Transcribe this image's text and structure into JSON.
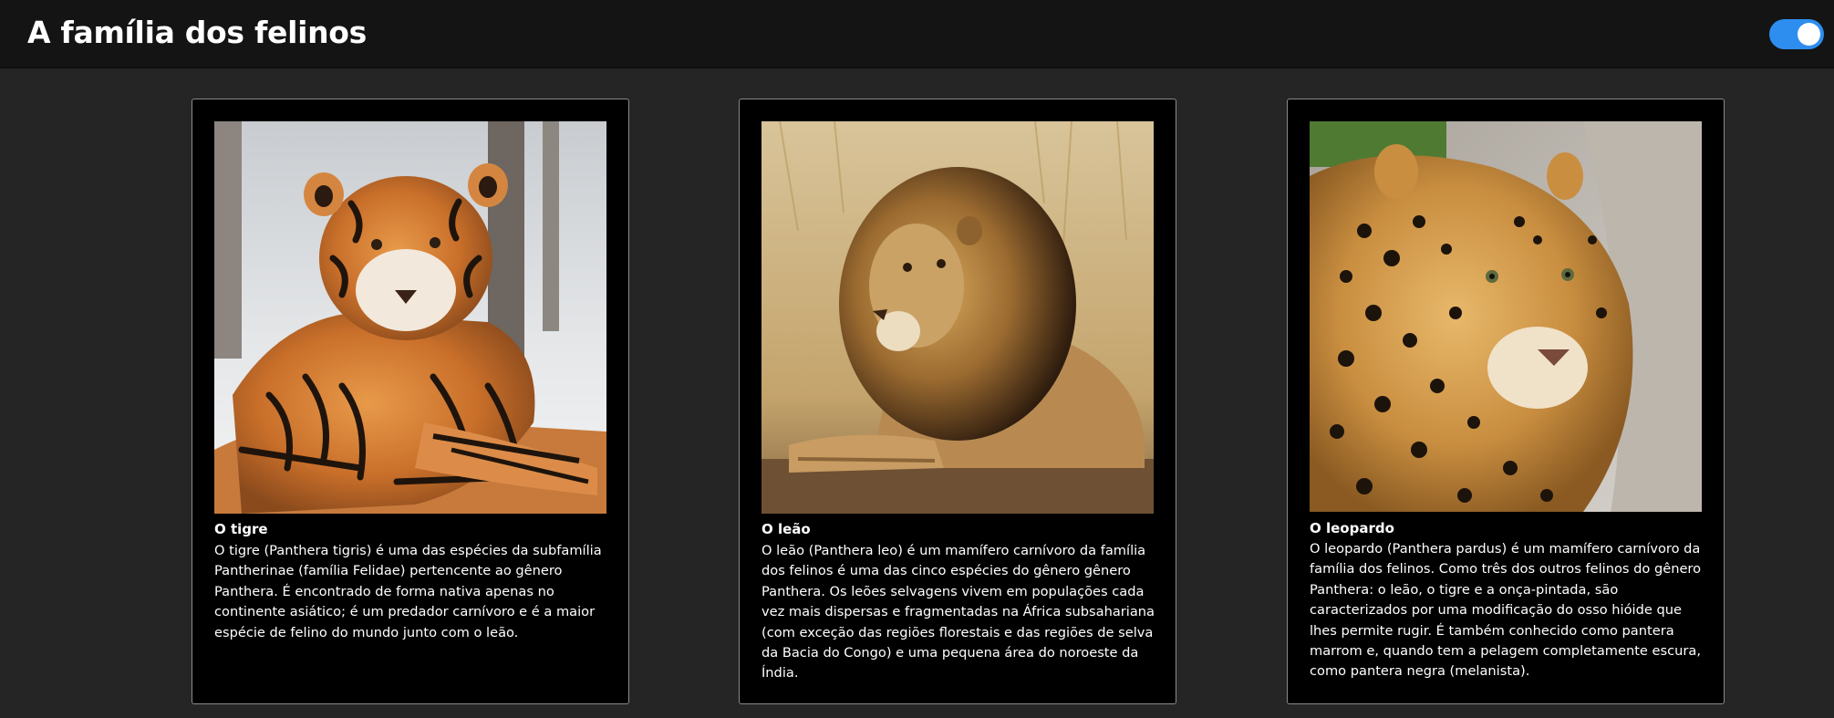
{
  "header": {
    "title": "A família dos felinos",
    "toggle_state": "on",
    "toggle_color": "#2d8ef0"
  },
  "cards": [
    {
      "image": "tiger-photo",
      "name": "O tigre",
      "description": "O tigre (Panthera tigris) é uma das espécies da subfamília Pantherinae (família Felidae) pertencente ao gênero Panthera. É encontrado de forma nativa apenas no continente asiático; é um predador carnívoro e é a maior espécie de felino do mundo junto com o leão."
    },
    {
      "image": "lion-photo",
      "name": "O leão",
      "description": "O leão (Panthera leo) é um mamífero carnívoro da família dos felinos é uma das cinco espécies do gênero gênero Panthera. Os leões selvagens vivem em populações cada vez mais dispersas e fragmentadas na África subsahariana (com exceção das regiões florestais e das regiões de selva da Bacia do Congo) e uma pequena área do noroeste da Índia."
    },
    {
      "image": "leopard-photo",
      "name": "O leopardo",
      "description": "O leopardo (Panthera pardus) é um mamífero carnívoro da família dos felinos. Como três dos outros felinos do gênero Panthera: o leão, o tigre e a onça-pintada, são caracterizados por uma modificação do osso hióide que lhes permite rugir. É também conhecido como pantera marrom e, quando tem a pelagem completamente escura, como pantera negra (melanista)."
    }
  ]
}
